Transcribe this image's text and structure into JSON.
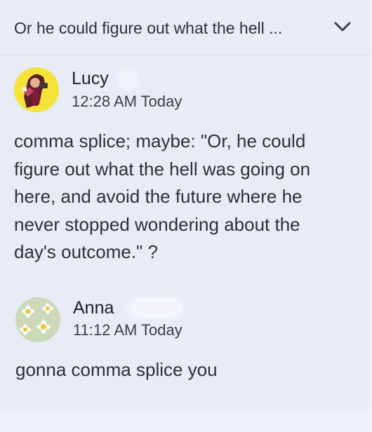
{
  "thread": {
    "preview": "Or he could figure out what the hell ...",
    "collapse_icon": "chevron-down-icon"
  },
  "comments": [
    {
      "author": "Lucy",
      "time": "12:28 AM Today",
      "body_lines": [
        "comma splice; maybe: \"Or, he could",
        "figure out what the hell was going on",
        "here, and avoid the future where he",
        "never stopped wondering about the",
        "day's outcome.\" ?"
      ],
      "avatar": "avatar-illustrated-woman"
    },
    {
      "author": "Anna",
      "time": "11:12 AM Today",
      "body_lines": [
        "gonna comma splice you"
      ],
      "avatar": "avatar-daisies"
    }
  ],
  "colors": {
    "card_bg": "#e8ecf7",
    "page_bg": "#eef1f8",
    "text": "#2f3033",
    "avatar_yellow": "#f6e33a"
  }
}
